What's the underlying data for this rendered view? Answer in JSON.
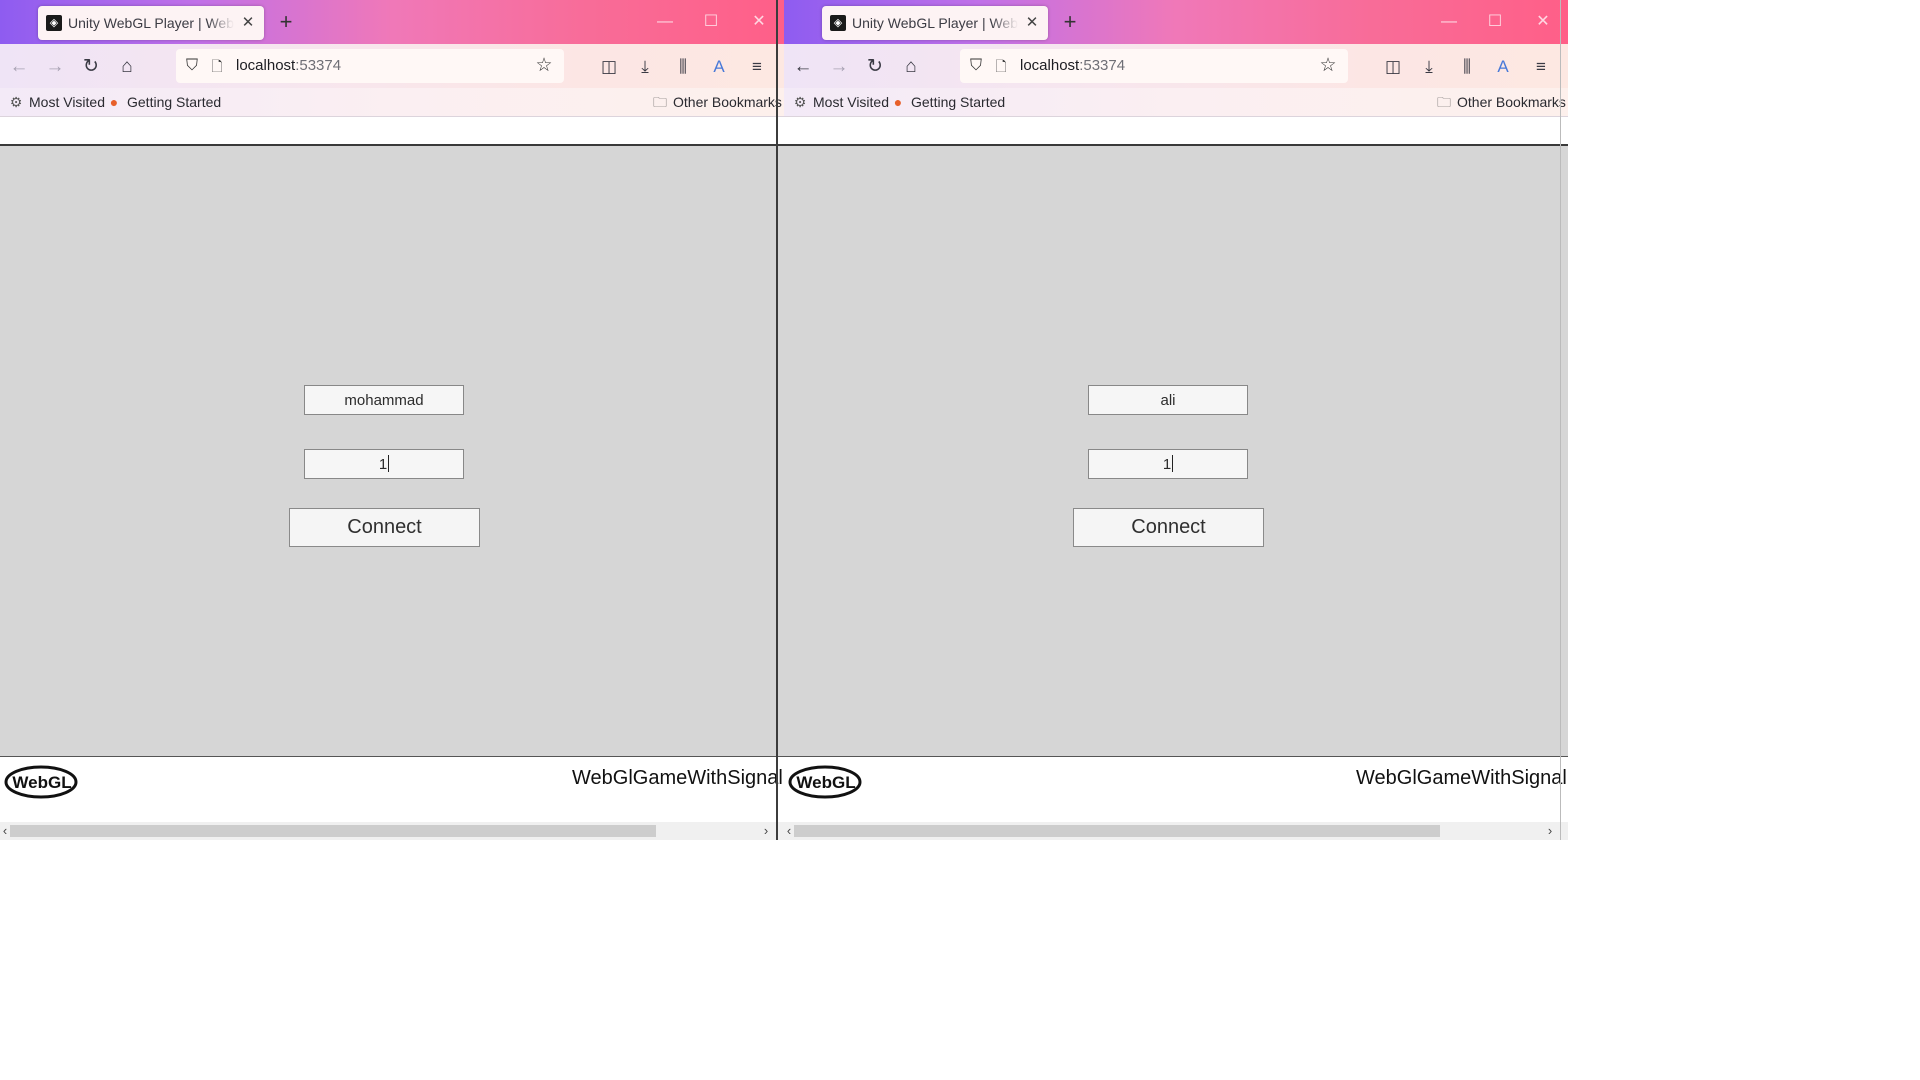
{
  "windows": [
    {
      "tab": {
        "title": "Unity WebGL Player | WebGlGameWithSignalR",
        "favicon": "unity-icon",
        "close": "✕"
      },
      "new_tab": "+",
      "controls": {
        "minimize": "—",
        "maximize": "☐",
        "close": "✕"
      },
      "nav": {
        "back": "←",
        "forward": "→",
        "reload": "↻",
        "home": "⌂"
      },
      "url": {
        "host": "localhost",
        "port": ":53374"
      },
      "bookmarks": [
        {
          "label": "Most Visited",
          "icon": "gear-icon"
        },
        {
          "label": "Getting Started",
          "icon": "firefox-icon"
        },
        {
          "label": "Other Bookmarks",
          "icon": "folder-icon"
        }
      ],
      "game": {
        "name_value": "mohammad",
        "room_value": "1",
        "connect_label": "Connect"
      },
      "footer": {
        "logo_text": "WebGL",
        "title": "WebGlGameWithSignalR"
      }
    },
    {
      "tab": {
        "title": "Unity WebGL Player | WebGlGameWithSignalR",
        "favicon": "unity-icon",
        "close": "✕"
      },
      "new_tab": "+",
      "controls": {
        "minimize": "—",
        "maximize": "☐",
        "close": "✕"
      },
      "nav": {
        "back": "←",
        "forward": "→",
        "reload": "↻",
        "home": "⌂"
      },
      "url": {
        "host": "localhost",
        "port": ":53374"
      },
      "bookmarks": [
        {
          "label": "Most Visited",
          "icon": "gear-icon"
        },
        {
          "label": "Getting Started",
          "icon": "firefox-icon"
        },
        {
          "label": "Other Bookmarks",
          "icon": "folder-icon"
        }
      ],
      "game": {
        "name_value": "ali",
        "room_value": "1",
        "connect_label": "Connect"
      },
      "footer": {
        "logo_text": "WebGL",
        "title": "WebGlGameWithSignalR"
      }
    }
  ],
  "icons": {
    "shield": "⛉",
    "page": "🗋",
    "star": "☆",
    "pocket": "◫",
    "download": "⤓",
    "library": "⫼",
    "extension": "A",
    "menu": "≡",
    "gear": "⚙",
    "firefox": "●",
    "folder": "🗀",
    "scroll_left": "‹",
    "scroll_right": "›"
  },
  "colors": {
    "titlebar_start": "#8e5cf0",
    "titlebar_end": "#ff5f88",
    "canvas_bg": "#d6d6d6"
  }
}
